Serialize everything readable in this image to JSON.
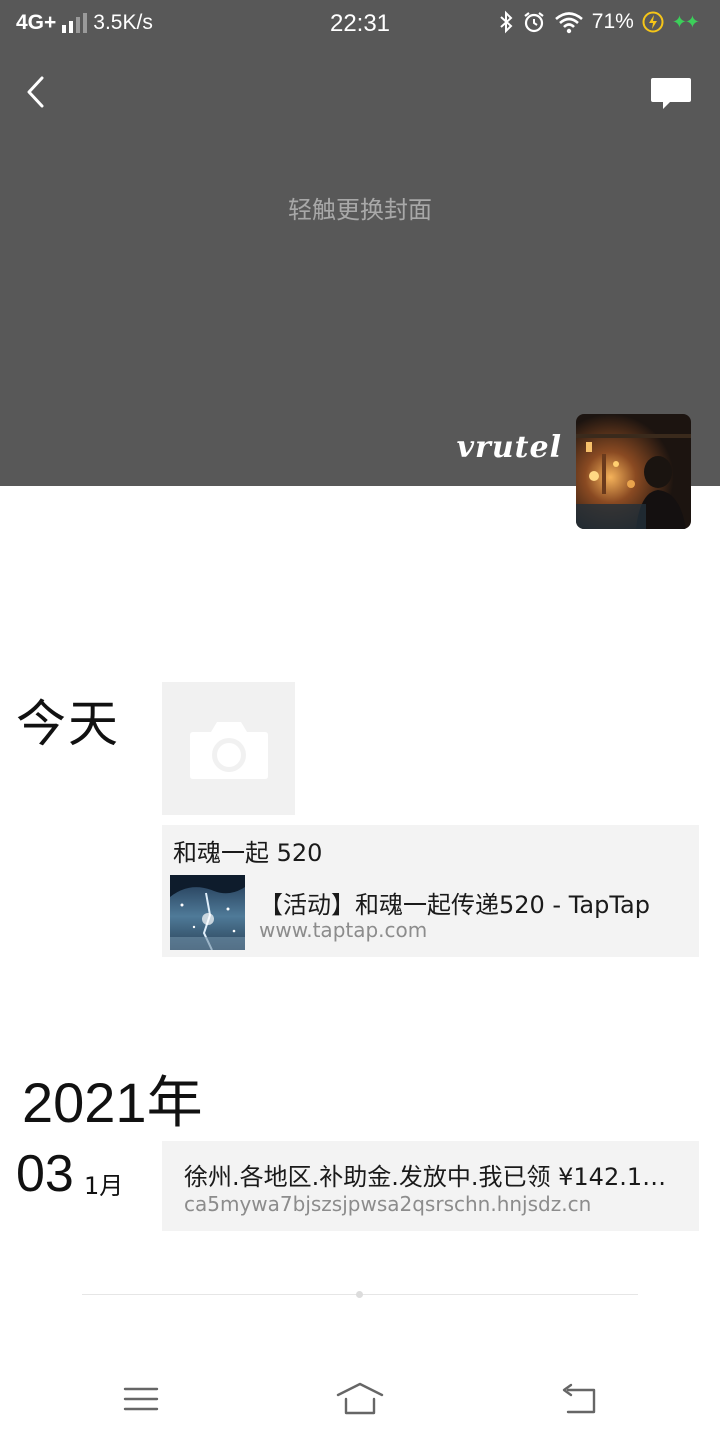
{
  "status_bar": {
    "network": "4G+",
    "speed": "3.5K/s",
    "time": "22:31",
    "battery": "71%",
    "icons": [
      "signal-icon",
      "bluetooth-icon",
      "alarm-icon",
      "wifi-icon",
      "charging-icon",
      "sparkle-icon"
    ]
  },
  "header": {
    "back_icon": "chevron-left-icon",
    "comment_icon": "comment-icon",
    "cover_hint": "轻触更换封面"
  },
  "profile": {
    "signature": "vrutel",
    "avatar": "avatar-photo"
  },
  "timeline": [
    {
      "day_label": "今天",
      "camera_icon": "camera-icon",
      "post": {
        "text": "和魂一起 520",
        "link_title": "【活动】和魂一起传递520 - TapTap",
        "link_domain": "www.taptap.com"
      }
    }
  ],
  "archive": {
    "year": "2021年",
    "entries": [
      {
        "day": "03",
        "month": "1月",
        "title": "徐州.各地区.补助金.发放中.我已领 ¥142.1…",
        "domain": "ca5mywa7bjszsjpwsa2qsrschn.hnjsdz.cn"
      }
    ]
  },
  "nav_bar": {
    "icons": [
      "menu-icon",
      "home-icon",
      "back-icon"
    ]
  },
  "colors": {
    "cover": "#585858",
    "card": "#f3f3f3",
    "muted_text": "#8c8c8c"
  }
}
